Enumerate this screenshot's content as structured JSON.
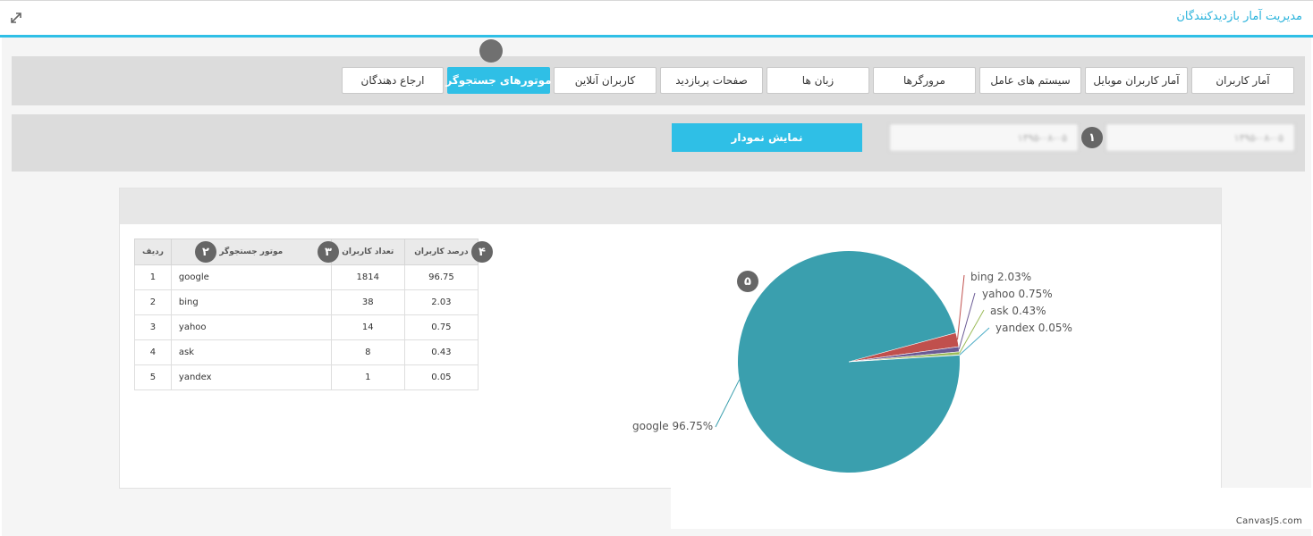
{
  "header": {
    "title": "مدیریت آمار بازدیدکنندگان"
  },
  "tabs": [
    {
      "label": "آمار کاربران",
      "active": false
    },
    {
      "label": "آمار کاربران موبایل",
      "active": false
    },
    {
      "label": "سیستم های عامل",
      "active": false
    },
    {
      "label": "مرورگرها",
      "active": false
    },
    {
      "label": "زبان ها",
      "active": false
    },
    {
      "label": "صفحات پربازدید",
      "active": false
    },
    {
      "label": "کاربران آنلاین",
      "active": false
    },
    {
      "label": "موتورهای جستجوگر",
      "active": true
    },
    {
      "label": "ارجاع دهندگان",
      "active": false
    }
  ],
  "filters": {
    "date_from": "۱۳۹۵-۰۸-۰۵",
    "date_to": "۱۳۹۵-۰۸-۰۵",
    "show_chart_label": "نمایش نمودار"
  },
  "badges": {
    "b1": "۱",
    "b2": "۲",
    "b3": "۳",
    "b4": "۴",
    "b5": "۵"
  },
  "table": {
    "headers": {
      "index": "ردیف",
      "engine": "موتور جستجوگر",
      "count": "تعداد کاربران",
      "percent": "درصد کاربران"
    },
    "rows": [
      {
        "index": "1",
        "engine": "google",
        "count": "1814",
        "percent": "96.75"
      },
      {
        "index": "2",
        "engine": "bing",
        "count": "38",
        "percent": "2.03"
      },
      {
        "index": "3",
        "engine": "yahoo",
        "count": "14",
        "percent": "0.75"
      },
      {
        "index": "4",
        "engine": "ask",
        "count": "8",
        "percent": "0.43"
      },
      {
        "index": "5",
        "engine": "yandex",
        "count": "1",
        "percent": "0.05"
      }
    ]
  },
  "chart_data": {
    "type": "pie",
    "categories": [
      "google",
      "bing",
      "yahoo",
      "ask",
      "yandex"
    ],
    "values": [
      96.75,
      2.03,
      0.75,
      0.43,
      0.05
    ],
    "labels": [
      "google  96.75%",
      "bing  2.03%",
      "yahoo  0.75%",
      "ask  0.43%",
      "yandex  0.05%"
    ],
    "colors": [
      "#3a9fae",
      "#c0504d",
      "#6b5b95",
      "#9bbb59",
      "#4bacc6"
    ]
  },
  "watermark": "CanvasJS.com",
  "colors": {
    "accent": "#2fbfe6",
    "badge": "#666666"
  }
}
